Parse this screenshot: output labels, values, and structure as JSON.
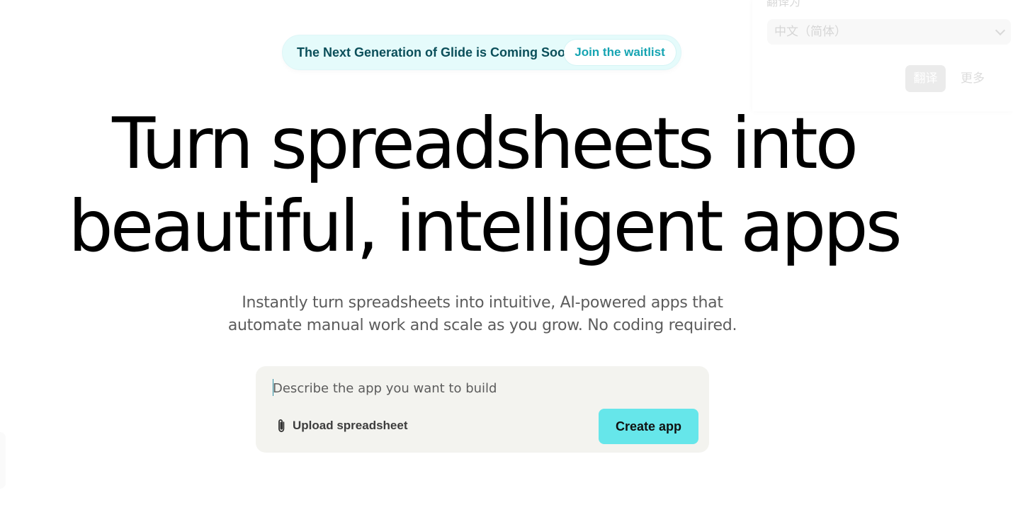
{
  "announcement": {
    "text": "The Next Generation of Glide is Coming Soon",
    "link_label": "Join the waitlist",
    "background": "#e5fbfb",
    "text_color": "#0b4f5a",
    "link_color": "#16a4b2"
  },
  "translate_overlay": {
    "label": "翻译为",
    "selected_language": "中文（简体）",
    "translate_button": "翻译",
    "more_button": "更多",
    "dropdown_icon": "chevron-down-icon"
  },
  "hero": {
    "title_line_1": "Turn spreadsheets into",
    "title_line_2": "beautiful, intelligent apps",
    "subtitle_line_1": "Instantly turn spreadsheets into intuitive, AI-powered apps that",
    "subtitle_line_2": "automate manual work and scale as you grow. No coding required."
  },
  "prompt": {
    "placeholder": "Describe the app you want to build",
    "value": "",
    "upload_label": "Upload spreadsheet",
    "upload_icon": "paperclip-icon",
    "create_button": "Create app",
    "card_background": "#f3f3ef",
    "button_color": "#66e6ea"
  }
}
